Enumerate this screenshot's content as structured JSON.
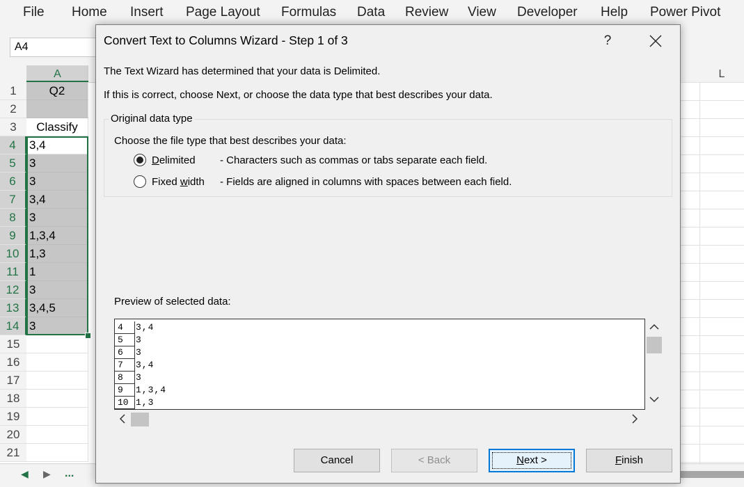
{
  "ribbon": {
    "tabs": [
      "File",
      "Home",
      "Insert",
      "Page Layout",
      "Formulas",
      "Data",
      "Review",
      "View",
      "Developer",
      "Help",
      "Power Pivot"
    ]
  },
  "formula_bar": {
    "name_box": "A4"
  },
  "grid": {
    "col_a": "A",
    "col_l": "L",
    "rows": [
      {
        "num": "1",
        "value": "Q2"
      },
      {
        "num": "2",
        "value": ""
      },
      {
        "num": "3",
        "value": "Classify"
      },
      {
        "num": "4",
        "value": "3,4"
      },
      {
        "num": "5",
        "value": "3"
      },
      {
        "num": "6",
        "value": "3"
      },
      {
        "num": "7",
        "value": "3,4"
      },
      {
        "num": "8",
        "value": "3"
      },
      {
        "num": "9",
        "value": "1,3,4"
      },
      {
        "num": "10",
        "value": "1,3"
      },
      {
        "num": "11",
        "value": "1"
      },
      {
        "num": "12",
        "value": "3"
      },
      {
        "num": "13",
        "value": "3,4,5"
      },
      {
        "num": "14",
        "value": "3"
      },
      {
        "num": "15",
        "value": ""
      },
      {
        "num": "16",
        "value": ""
      },
      {
        "num": "17",
        "value": ""
      },
      {
        "num": "18",
        "value": ""
      },
      {
        "num": "19",
        "value": ""
      },
      {
        "num": "20",
        "value": ""
      },
      {
        "num": "21",
        "value": ""
      }
    ]
  },
  "sheetbar": {
    "more": "..."
  },
  "dialog": {
    "title": "Convert Text to Columns Wizard - Step 1 of 3",
    "help": "?",
    "line1": "The Text Wizard has determined that your data is Delimited.",
    "line2": "If this is correct, choose Next, or choose the data type that best describes your data.",
    "group_title": "Original data type",
    "choose_label": "Choose the file type that best describes your data:",
    "options": [
      {
        "label_u": "D",
        "label_rest": "elimited",
        "desc": "- Characters such as commas or tabs separate each field.",
        "checked": true
      },
      {
        "label_pre": "Fixed ",
        "label_u": "w",
        "label_rest": "idth",
        "desc": "- Fields are aligned in columns with spaces between each field.",
        "checked": false
      }
    ],
    "preview_label": "Preview of selected data:",
    "preview_rows": [
      {
        "num": "4",
        "value": "3,4"
      },
      {
        "num": "5",
        "value": "3"
      },
      {
        "num": "6",
        "value": "3"
      },
      {
        "num": "7",
        "value": "3,4"
      },
      {
        "num": "8",
        "value": "3"
      },
      {
        "num": "9",
        "value": "1,3,4"
      },
      {
        "num": "10",
        "value": "1,3"
      }
    ],
    "buttons": {
      "cancel": "Cancel",
      "back": "< Back",
      "next_u": "N",
      "next_rest": "ext >",
      "finish_u": "F",
      "finish_rest": "inish"
    }
  }
}
